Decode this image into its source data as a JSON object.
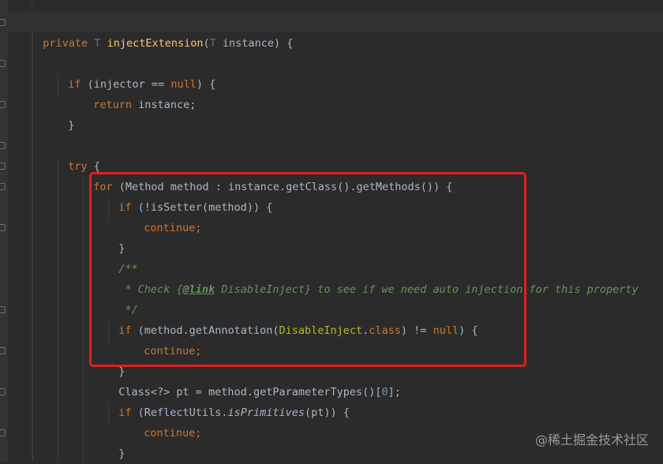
{
  "code": {
    "line1": {
      "kw": "private",
      "type": "T",
      "fn": "injectExtension",
      "p1": "(",
      "ptype": "T",
      "p2": " instance) {"
    },
    "line2": {
      "kw": "if",
      "p1": " (injector == ",
      "null": "null",
      "p2": ") {"
    },
    "line3": {
      "kw": "return",
      "p1": " instance;"
    },
    "line4": {
      "text": "}"
    },
    "line5": {
      "kw": "try",
      "p1": " {"
    },
    "line6": {
      "kw": "for",
      "p1": " (Method method : instance.getClass().getMethods()) {"
    },
    "line7": {
      "kw": "if",
      "p1": " (!isSetter(method)) {"
    },
    "line8": {
      "kw": "continue",
      "p1": ";"
    },
    "line9": {
      "text": "}"
    },
    "line10": {
      "text": "/**"
    },
    "line11": {
      "c1": " * Check {",
      "tag": "@link",
      "c2": " DisableInject",
      "c3": "} to see if we need auto injection for this property"
    },
    "line12": {
      "text": " */"
    },
    "line13": {
      "kw": "if",
      "p1": " (method.getAnnotation(",
      "cls": "DisableInject",
      "dot": ".",
      "classkw": "class",
      "p2": ") != ",
      "null": "null",
      "p3": ") {"
    },
    "line14": {
      "kw": "continue",
      "p1": ";"
    },
    "line15": {
      "text": "}"
    },
    "line16": {
      "p1": "Class<?> pt = method.getParameterTypes()[",
      "num": "0",
      "p2": "];"
    },
    "line17": {
      "kw": "if",
      "p1": " (ReflectUtils.",
      "fn": "isPrimitives",
      "p2": "(pt)) {"
    },
    "line18": {
      "kw": "continue",
      "p1": ";"
    },
    "line19": {
      "text": "}"
    }
  },
  "watermark": "@稀土掘金技术社区",
  "colors": {
    "background": "#2b2b2b",
    "keyword": "#cc7832",
    "method": "#ffc66d",
    "comment": "#629755",
    "highlight_box": "#e02020"
  }
}
